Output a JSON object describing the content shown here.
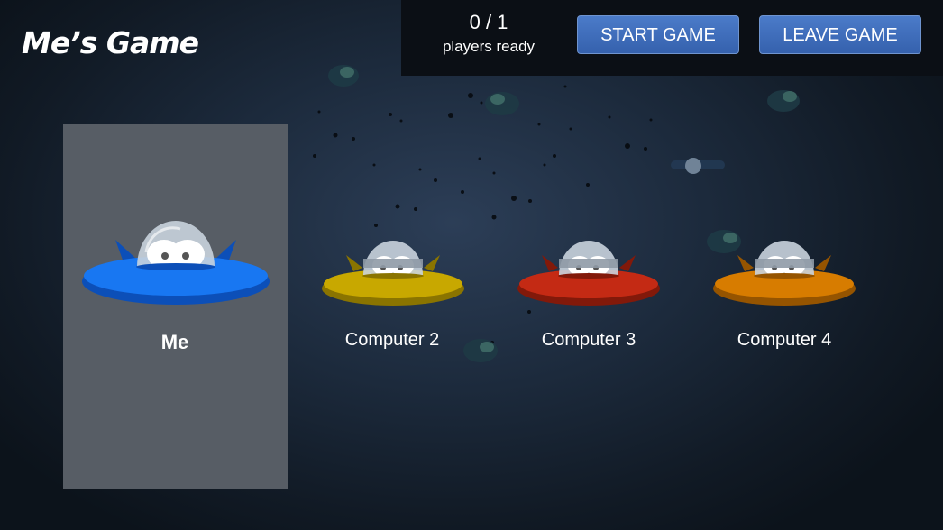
{
  "header": {
    "title": "Me’s Game"
  },
  "status": {
    "ready_count": "0 / 1",
    "ready_label": "players ready"
  },
  "buttons": {
    "start": "START GAME",
    "leave": "LEAVE GAME"
  },
  "players": [
    {
      "name": "Me",
      "color": "#1877f2",
      "dark": "#0c4fb8",
      "selected": true
    },
    {
      "name": "Computer 2",
      "color": "#c8a800",
      "dark": "#8a7400"
    },
    {
      "name": "Computer 3",
      "color": "#c42a14",
      "dark": "#82190a"
    },
    {
      "name": "Computer 4",
      "color": "#d77c00",
      "dark": "#955400"
    }
  ]
}
